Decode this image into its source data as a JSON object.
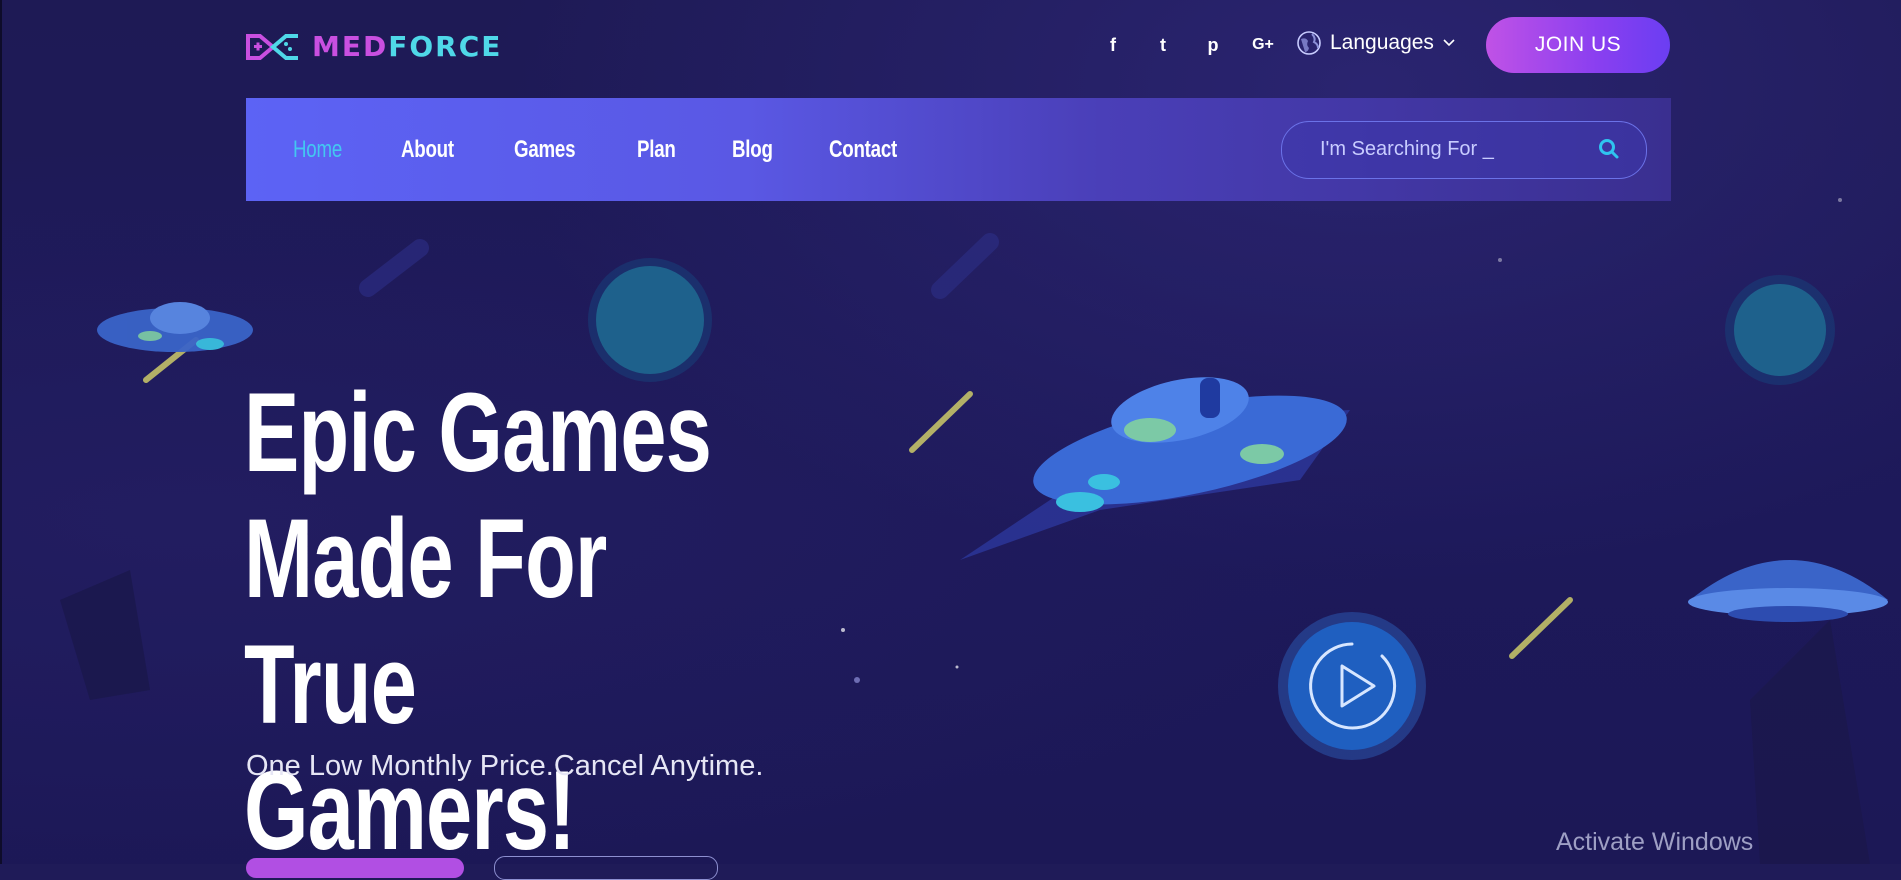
{
  "brand": {
    "part1": "MED",
    "part2": "FORCE"
  },
  "social": [
    {
      "icon": "facebook-icon",
      "glyph": "f"
    },
    {
      "icon": "twitter-icon",
      "glyph": "t"
    },
    {
      "icon": "pinterest-icon",
      "glyph": "p"
    },
    {
      "icon": "google-plus-icon",
      "glyph": "G+"
    }
  ],
  "languages": {
    "label": "Languages"
  },
  "join": {
    "label": "JOIN US"
  },
  "nav": {
    "items": [
      {
        "label": "Home",
        "active": true
      },
      {
        "label": "About"
      },
      {
        "label": "Games"
      },
      {
        "label": "Plan"
      },
      {
        "label": "Blog"
      },
      {
        "label": "Contact"
      }
    ]
  },
  "search": {
    "placeholder": "I'm Searching For _"
  },
  "hero": {
    "line1": "Epic Games",
    "line2": "Made For True",
    "line3": "Gamers!",
    "subtitle": "One Low Monthly Price.Cancel Anytime."
  },
  "watermark": "Activate Windows",
  "colors": {
    "background": "#1f1b58",
    "nav_start": "#5c63f5",
    "accent_cyan": "#43c7f1",
    "join_gradient_start": "#c052e6",
    "join_gradient_end": "#6b3ef2"
  }
}
